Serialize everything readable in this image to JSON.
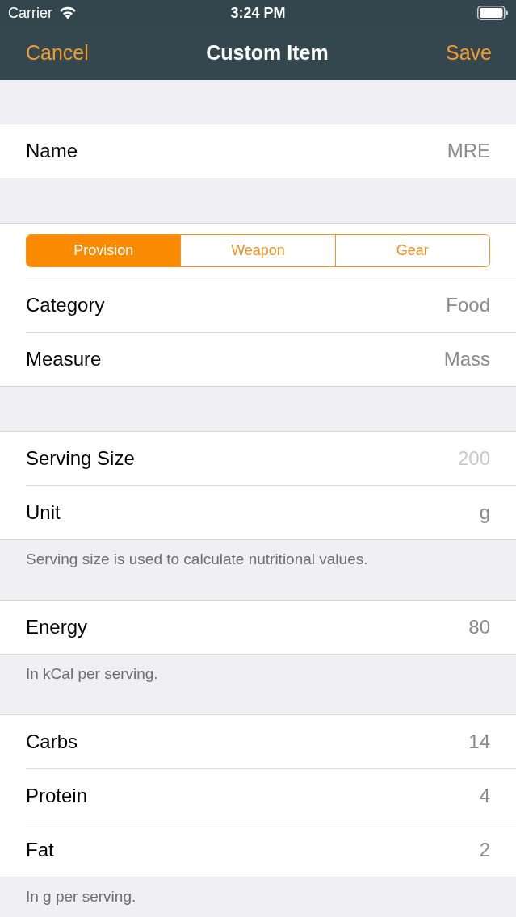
{
  "status_bar": {
    "carrier": "Carrier",
    "time": "3:24 PM"
  },
  "nav_bar": {
    "cancel": "Cancel",
    "title": "Custom Item",
    "save": "Save"
  },
  "sections": [
    {
      "rows": [
        {
          "kind": "value",
          "label": "Name",
          "value": "MRE"
        }
      ]
    },
    {
      "segments": [
        {
          "label": "Provision",
          "selected": true
        },
        {
          "label": "Weapon",
          "selected": false
        },
        {
          "label": "Gear",
          "selected": false
        }
      ],
      "rows": [
        {
          "kind": "value",
          "label": "Category",
          "value": "Food"
        },
        {
          "kind": "value",
          "label": "Measure",
          "value": "Mass"
        }
      ]
    },
    {
      "rows": [
        {
          "kind": "field",
          "label": "Serving Size",
          "placeholder": "200"
        },
        {
          "kind": "value",
          "label": "Unit",
          "value": "g"
        }
      ],
      "footer": "Serving size is used to calculate nutritional values."
    },
    {
      "rows": [
        {
          "kind": "value",
          "label": "Energy",
          "value": "80"
        }
      ],
      "footer": "In kCal per serving."
    },
    {
      "rows": [
        {
          "kind": "value",
          "label": "Carbs",
          "value": "14"
        },
        {
          "kind": "value",
          "label": "Protein",
          "value": "4"
        },
        {
          "kind": "value",
          "label": "Fat",
          "value": "2"
        }
      ],
      "footer": "In g per serving."
    }
  ]
}
